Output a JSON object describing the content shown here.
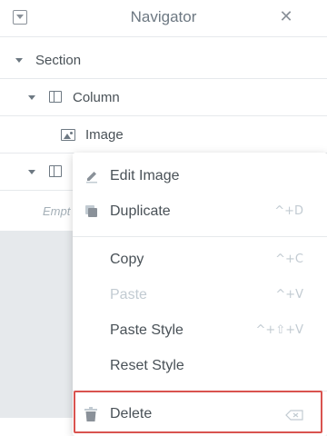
{
  "header": {
    "title": "Navigator",
    "close_glyph": "✕"
  },
  "tree": [
    {
      "label": "Section",
      "level": 0
    },
    {
      "label": "Column",
      "level": 1
    },
    {
      "label": "Image",
      "level": 2
    },
    {
      "label": "",
      "level": 1
    }
  ],
  "empty": {
    "text": "Empt"
  },
  "context_menu": {
    "items": [
      {
        "label": "Edit Image",
        "shortcut": "",
        "icon": "pencil-icon",
        "disabled": false
      },
      {
        "label": "Duplicate",
        "shortcut": "^+D",
        "icon": "duplicate-icon",
        "disabled": false
      },
      {
        "label": "Copy",
        "shortcut": "^+C",
        "disabled": false
      },
      {
        "label": "Paste",
        "shortcut": "^+V",
        "disabled": true
      },
      {
        "label": "Paste Style",
        "shortcut": "^+⇧+V",
        "disabled": false
      },
      {
        "label": "Reset Style",
        "shortcut": "",
        "disabled": false
      },
      {
        "label": "Delete",
        "shortcut": "",
        "icon": "trash-icon",
        "shortcut_icon": "backspace-icon",
        "disabled": false,
        "highlighted": true
      }
    ]
  },
  "colors": {
    "highlight_border": "#d9534f",
    "text": "#495157",
    "muted": "#c2cbd2"
  }
}
